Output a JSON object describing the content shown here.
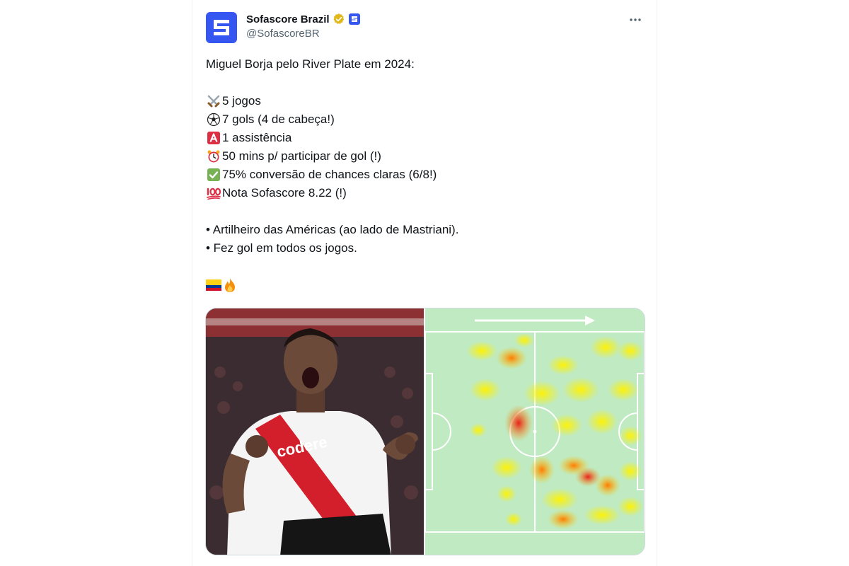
{
  "tweet": {
    "author": {
      "display_name": "Sofascore Brazil",
      "handle": "@SofascoreBR",
      "verified": true,
      "avatar_icon": "sofascore-logo-icon",
      "brand_color": "#3556f0"
    },
    "text": {
      "intro": "Miguel Borja pelo River Plate em 2024:",
      "stats": [
        {
          "icon": "crossed-swords-icon",
          "text": "5 jogos"
        },
        {
          "icon": "soccer-ball-icon",
          "text": "7 gols (4 de cabeça!)"
        },
        {
          "icon": "a-button-icon",
          "text": "1 assistência"
        },
        {
          "icon": "alarm-clock-icon",
          "text": "50 mins p/ participar de gol (!)"
        },
        {
          "icon": "check-mark-icon",
          "text": "75% conversão de chances claras (6/8!)"
        },
        {
          "icon": "hundred-points-icon",
          "text": "Nota Sofascore 8.22 (!)"
        }
      ],
      "bullets": [
        "• Artilheiro das Américas (ao lado de Mastriani).",
        "• Fez gol em todos os jogos."
      ],
      "closing_emojis": [
        "colombia-flag-icon",
        "fire-icon"
      ]
    },
    "media": {
      "photo_jersey_text": "codere",
      "heatmap_direction": "attack-right-arrow"
    },
    "colors": {
      "text_primary": "#0f1419",
      "text_secondary": "#536471",
      "pitch": "#bfeac2"
    }
  }
}
